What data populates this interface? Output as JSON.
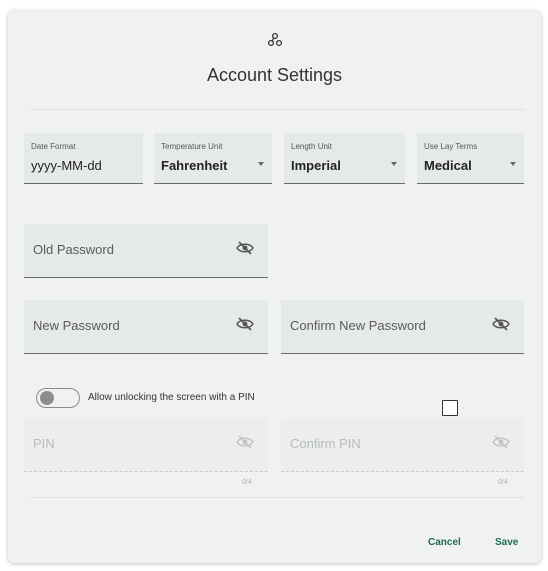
{
  "dialog": {
    "title": "Account Settings",
    "logo_icon": "molecule-logo-icon",
    "accent_color": "#1e6a55"
  },
  "settings": {
    "date_format": {
      "label": "Date Format",
      "value": "yyyy-MM-dd"
    },
    "temperature_unit": {
      "label": "Temperature Unit",
      "value": "Fahrenheit"
    },
    "length_unit": {
      "label": "Length Unit",
      "value": "Imperial"
    },
    "lay_terms": {
      "label": "Use Lay Terms",
      "value": "Medical"
    }
  },
  "passwords": {
    "old": {
      "placeholder": "Old Password",
      "icon": "eye-off-icon"
    },
    "new": {
      "placeholder": "New Password",
      "icon": "eye-off-icon"
    },
    "confirm": {
      "placeholder": "Confirm New Password",
      "icon": "eye-off-icon"
    }
  },
  "pin": {
    "toggle_label": "Allow unlocking the screen with a PIN",
    "toggle_on": false,
    "checkbox_checked": false,
    "pin_placeholder": "PIN",
    "confirm_placeholder": "Confirm PIN",
    "pin_counter": "0/4",
    "confirm_counter": "0/4"
  },
  "actions": {
    "cancel": "Cancel",
    "save": "Save"
  }
}
